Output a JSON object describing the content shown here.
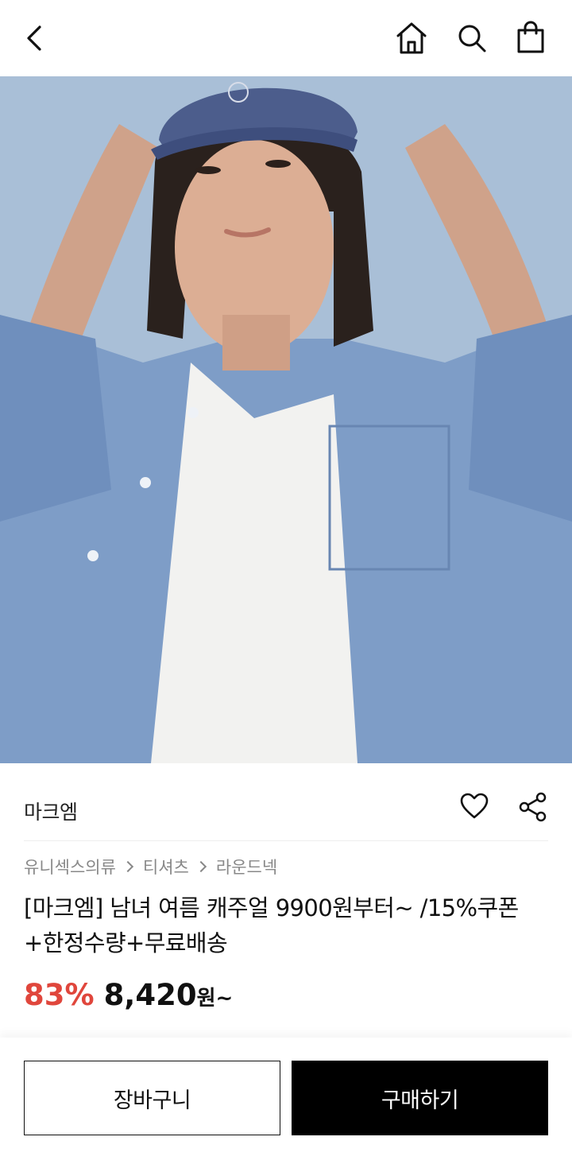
{
  "header": {
    "back_icon": "chevron-left-icon",
    "home_icon": "home-icon",
    "search_icon": "search-icon",
    "bag_icon": "shopping-bag-icon"
  },
  "hero": {
    "image": "model-blue-shirt-photo",
    "background_color": "#a9bfd7"
  },
  "product": {
    "brand": "마크엠",
    "like_icon": "heart-icon",
    "share_icon": "share-icon",
    "breadcrumb": [
      "유니섹스의류",
      "티셔츠",
      "라운드넥"
    ],
    "title": "[마크엠] 남녀 여름 캐주얼 9900원부터~ /15%쿠폰+한정수량+무료배송",
    "discount": "83%",
    "price": "8,420",
    "price_suffix": "원~",
    "discount_color": "#e0463c"
  },
  "actions": {
    "cart_label": "장바구니",
    "buy_label": "구매하기"
  }
}
